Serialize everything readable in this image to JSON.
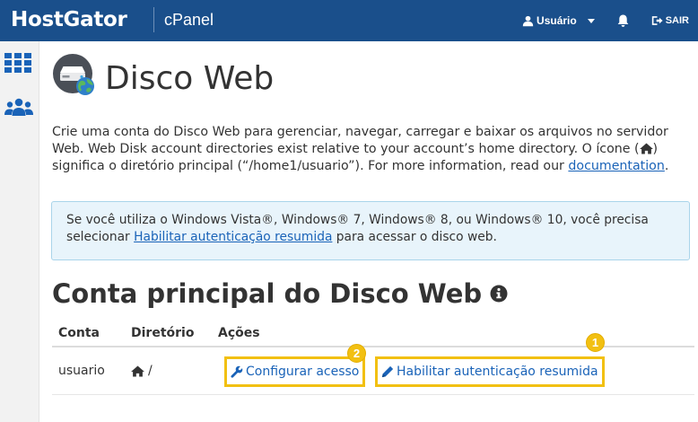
{
  "topbar": {
    "brand": "HostGator",
    "product": "cPanel",
    "user_label": "Usuário",
    "logout_label": "SAIR"
  },
  "sidebar": {
    "items": [
      {
        "icon": "grid-icon"
      },
      {
        "icon": "users-icon"
      }
    ]
  },
  "page": {
    "title": "Disco Web",
    "description_part1": "Crie uma conta do Disco Web para gerenciar, navegar, carregar e baixar os arquivos no servidor Web. Web Disk account directories exist relative to your account’s home directory. O ícone (",
    "description_part2": ") significa o diretório principal (“/home1/usuario”). For more information, read our ",
    "documentation_link": "documentation",
    "description_end": "."
  },
  "alert": {
    "text": "Se você utiliza o Windows Vista®, Windows® 7, Windows® 8, ou Windows® 10, você precisa selecionar ",
    "link": "Habilitar autenticação resumida",
    "text_end": " para acessar o disco web."
  },
  "section": {
    "title": "Conta principal do Disco Web"
  },
  "table": {
    "headers": [
      "Conta",
      "Diretório",
      "Ações"
    ],
    "rows": [
      {
        "account": "usuario",
        "directory": "/",
        "actions": [
          {
            "label": "Configurar acesso",
            "badge": "2"
          },
          {
            "label": "Habilitar autenticação resumida",
            "badge": "1"
          }
        ]
      }
    ]
  },
  "colors": {
    "topbar": "#1a4f8b",
    "link": "#1a63b8",
    "highlight": "#f2c012",
    "alert_bg": "#e8f4fb"
  }
}
